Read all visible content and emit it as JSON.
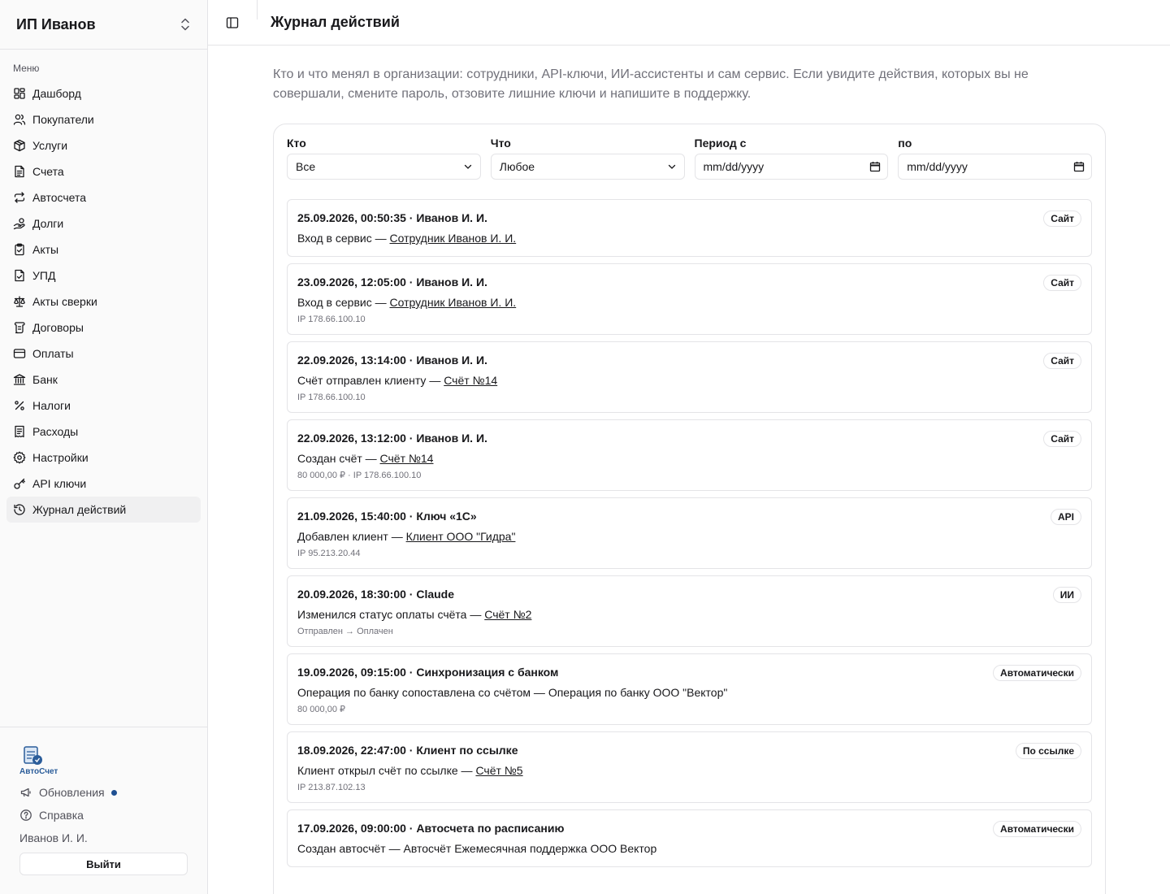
{
  "sidebar": {
    "org_name": "ИП Иванов",
    "menu_caption": "Меню",
    "items": [
      {
        "label": "Дашборд",
        "icon": "dashboard-icon"
      },
      {
        "label": "Покупатели",
        "icon": "users-icon"
      },
      {
        "label": "Услуги",
        "icon": "box-icon"
      },
      {
        "label": "Счета",
        "icon": "file-text-icon"
      },
      {
        "label": "Автосчета",
        "icon": "repeat-icon"
      },
      {
        "label": "Долги",
        "icon": "hand-coins-icon"
      },
      {
        "label": "Акты",
        "icon": "clipboard-check-icon"
      },
      {
        "label": "УПД",
        "icon": "file-check-icon"
      },
      {
        "label": "Акты сверки",
        "icon": "scale-icon"
      },
      {
        "label": "Договоры",
        "icon": "scroll-icon"
      },
      {
        "label": "Оплаты",
        "icon": "credit-card-icon"
      },
      {
        "label": "Банк",
        "icon": "landmark-icon"
      },
      {
        "label": "Налоги",
        "icon": "percent-icon"
      },
      {
        "label": "Расходы",
        "icon": "receipt-icon"
      },
      {
        "label": "Настройки",
        "icon": "gear-icon"
      },
      {
        "label": "API ключи",
        "icon": "key-icon"
      },
      {
        "label": "Журнал действий",
        "icon": "history-icon"
      }
    ],
    "active_index": 16,
    "logo_text": "АвтоСчет",
    "updates_label": "Обновления",
    "help_label": "Справка",
    "user_name": "Иванов И. И.",
    "logout_label": "Выйти"
  },
  "header": {
    "title": "Журнал действий"
  },
  "intro": "Кто и что менял в организации: сотрудники, API-ключи, ИИ-ассистенты и сам сервис. Если увидите действия, которых вы не совершали, смените пароль, отзовите лишние ключи и напишите в поддержку.",
  "filters": {
    "who": {
      "label": "Кто",
      "value": "Все"
    },
    "what": {
      "label": "Что",
      "value": "Любое"
    },
    "from": {
      "label": "Период с",
      "placeholder": "mm/dd/yyyy"
    },
    "to": {
      "label": "по",
      "placeholder": "mm/dd/yyyy"
    }
  },
  "events": [
    {
      "head": "25.09.2026, 00:50:35 · Иванов И. И.",
      "text": "Вход в сервис — ",
      "link": "Сотрудник Иванов И. И.",
      "meta": "",
      "badge": "Сайт"
    },
    {
      "head": "23.09.2026, 12:05:00 · Иванов И. И.",
      "text": "Вход в сервис — ",
      "link": "Сотрудник Иванов И. И.",
      "meta": "IP 178.66.100.10",
      "badge": "Сайт"
    },
    {
      "head": "22.09.2026, 13:14:00 · Иванов И. И.",
      "text": "Счёт отправлен клиенту — ",
      "link": "Счёт №14",
      "meta": "IP 178.66.100.10",
      "badge": "Сайт"
    },
    {
      "head": "22.09.2026, 13:12:00 · Иванов И. И.",
      "text": "Создан счёт — ",
      "link": "Счёт №14",
      "meta": "80 000,00 ₽ · IP 178.66.100.10",
      "badge": "Сайт"
    },
    {
      "head": "21.09.2026, 15:40:00 · Ключ «1С»",
      "text": "Добавлен клиент — ",
      "link": "Клиент ООО \"Гидра\"",
      "meta": "IP 95.213.20.44",
      "badge": "API"
    },
    {
      "head": "20.09.2026, 18:30:00 · Claude",
      "text": "Изменился статус оплаты счёта — ",
      "link": "Счёт №2",
      "meta": "Отправлен → Оплачен",
      "badge": "ИИ"
    },
    {
      "head": "19.09.2026, 09:15:00 · Синхронизация с банком",
      "text": "Операция по банку сопоставлена со счётом — Операция по банку ООО \"Вектор\"",
      "link": "",
      "meta": "80 000,00 ₽",
      "badge": "Автоматически"
    },
    {
      "head": "18.09.2026, 22:47:00 · Клиент по ссылке",
      "text": "Клиент открыл счёт по ссылке — ",
      "link": "Счёт №5",
      "meta": "IP 213.87.102.13",
      "badge": "По ссылке"
    },
    {
      "head": "17.09.2026, 09:00:00 · Автосчета по расписанию",
      "text": "Создан автосчёт — Автосчёт Ежемесячная поддержка ООО Вектор",
      "link": "",
      "meta": "",
      "badge": "Автоматически"
    }
  ]
}
